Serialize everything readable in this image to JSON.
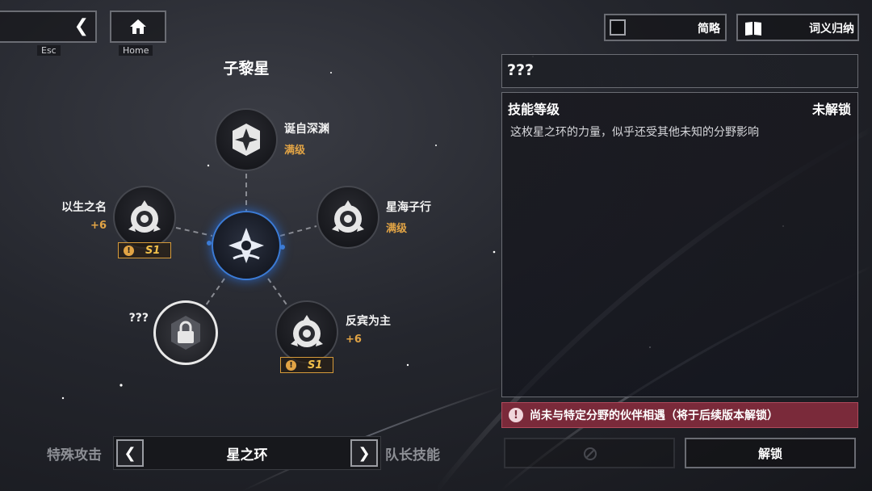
{
  "nav": {
    "back_key": "Esc",
    "home_key": "Home"
  },
  "constellation": {
    "title": "子黎星",
    "nodes": [
      {
        "name": "诞自深渊",
        "status": "满级"
      },
      {
        "name": "以生之名",
        "status": "+6"
      },
      {
        "name": "星海子行",
        "status": "满级"
      },
      {
        "name": "???",
        "status": ""
      },
      {
        "name": "反宾为主",
        "status": "+6"
      }
    ],
    "badge_text": "S1"
  },
  "bottom_nav": {
    "left_label": "特殊攻击",
    "current": "星之环",
    "right_label": "队长技能"
  },
  "top_right": {
    "summary_label": "简略",
    "glossary_label": "词义归纳"
  },
  "detail": {
    "name": "???",
    "level_label": "技能等级",
    "level_status": "未解锁",
    "description": "这枚星之环的力量，似乎还受其他未知的分野影响",
    "warning": "尚未与特定分野的伙伴相遇（将于后续版本解锁）",
    "unlock_label": "解锁"
  },
  "colors": {
    "accent_gold": "#e2a445",
    "warning_bg": "#7a2a3a",
    "core_blue": "#3b7bd6"
  }
}
